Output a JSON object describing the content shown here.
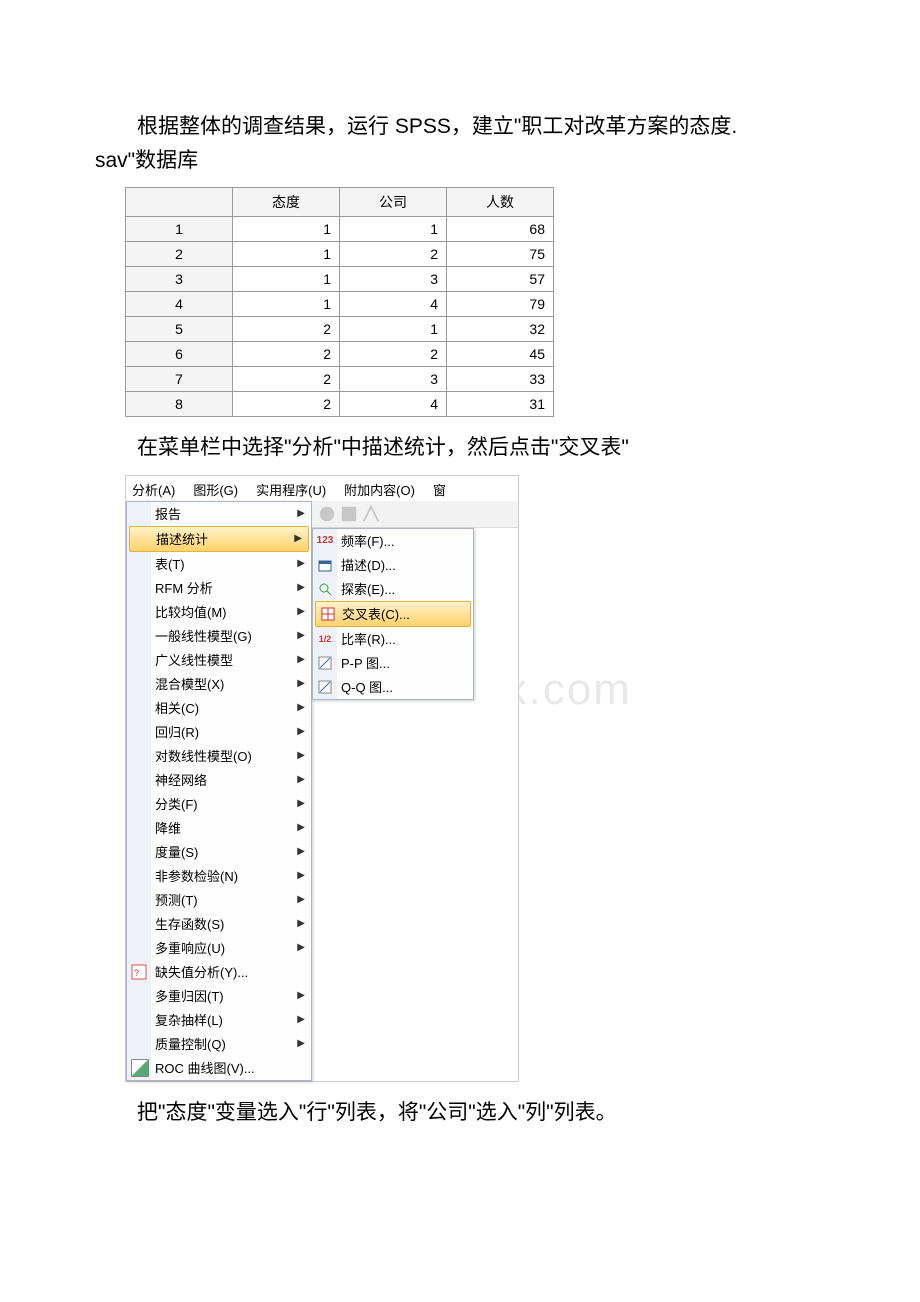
{
  "text": {
    "p1_a": "根据整体的调查结果，运行 SPSS，建立\"职工对改革方案的态度.",
    "p1_b": "sav\"数据库",
    "p2": "在菜单栏中选择\"分析\"中描述统计，然后点击\"交叉表\"",
    "p3": "把\"态度\"变量选入\"行\"列表，将\"公司\"选入\"列\"列表。"
  },
  "watermark": "www.bdocx.com",
  "table": {
    "headers": [
      "",
      "态度",
      "公司",
      "人数"
    ],
    "rows": [
      [
        "1",
        "1",
        "1",
        "68"
      ],
      [
        "2",
        "1",
        "2",
        "75"
      ],
      [
        "3",
        "1",
        "3",
        "57"
      ],
      [
        "4",
        "1",
        "4",
        "79"
      ],
      [
        "5",
        "2",
        "1",
        "32"
      ],
      [
        "6",
        "2",
        "2",
        "45"
      ],
      [
        "7",
        "2",
        "3",
        "33"
      ],
      [
        "8",
        "2",
        "4",
        "31"
      ]
    ]
  },
  "menubar": {
    "analyze": "分析(A)",
    "graphs": "图形(G)",
    "util": "实用程序(U)",
    "addons": "附加内容(O)",
    "window": "窗"
  },
  "menu_left": [
    {
      "label": "报告",
      "arrow": true
    },
    {
      "label": "描述统计",
      "arrow": true,
      "hl": true
    },
    {
      "label": "表(T)",
      "arrow": true
    },
    {
      "label": "RFM 分析",
      "arrow": true
    },
    {
      "label": "比较均值(M)",
      "arrow": true
    },
    {
      "label": "一般线性模型(G)",
      "arrow": true
    },
    {
      "label": "广义线性模型",
      "arrow": true
    },
    {
      "label": "混合模型(X)",
      "arrow": true
    },
    {
      "label": "相关(C)",
      "arrow": true
    },
    {
      "label": "回归(R)",
      "arrow": true
    },
    {
      "label": "对数线性模型(O)",
      "arrow": true
    },
    {
      "label": "神经网络",
      "arrow": true
    },
    {
      "label": "分类(F)",
      "arrow": true
    },
    {
      "label": "降维",
      "arrow": true
    },
    {
      "label": "度量(S)",
      "arrow": true
    },
    {
      "label": "非参数检验(N)",
      "arrow": true
    },
    {
      "label": "预测(T)",
      "arrow": true
    },
    {
      "label": "生存函数(S)",
      "arrow": true
    },
    {
      "label": "多重响应(U)",
      "arrow": true
    },
    {
      "label": "缺失值分析(Y)...",
      "arrow": false,
      "icon": "missing"
    },
    {
      "label": "多重归因(T)",
      "arrow": true
    },
    {
      "label": "复杂抽样(L)",
      "arrow": true
    },
    {
      "label": "质量控制(Q)",
      "arrow": true
    },
    {
      "label": "ROC 曲线图(V)...",
      "arrow": false,
      "icon": "roc"
    }
  ],
  "menu_right": [
    {
      "icon": "123",
      "label": "频率(F)..."
    },
    {
      "icon": "desc",
      "label": "描述(D)..."
    },
    {
      "icon": "explore",
      "label": "探索(E)..."
    },
    {
      "icon": "cross",
      "label": "交叉表(C)...",
      "hl": true
    },
    {
      "icon": "ratio",
      "label": "比率(R)..."
    },
    {
      "icon": "pp",
      "label": "P-P 图..."
    },
    {
      "icon": "qq",
      "label": "Q-Q 图..."
    }
  ]
}
